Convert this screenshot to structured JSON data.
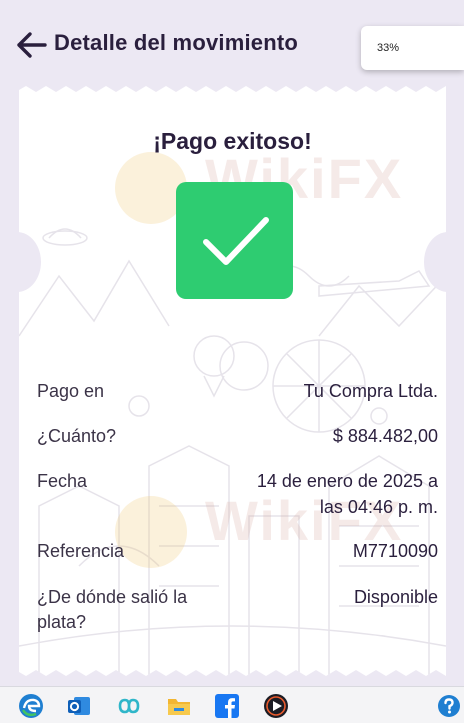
{
  "header": {
    "title": "Detalle del movimiento"
  },
  "zoom_popup": {
    "value": "33%"
  },
  "receipt": {
    "success_title": "¡Pago exitoso!",
    "rows": [
      {
        "label": "Pago en",
        "value": "Tu Compra Ltda."
      },
      {
        "label": "¿Cuánto?",
        "value": "$ 884.482,00"
      },
      {
        "label": "Fecha",
        "value_line1": "14 de enero de 2025 a",
        "value_line2": "las 04:46 p. m."
      },
      {
        "label": "Referencia",
        "value": "M7710090"
      },
      {
        "label_line1": "¿De dónde salió la",
        "label_line2": "plata?",
        "value": "Disponible"
      }
    ],
    "watermark_text": "WikiFX"
  },
  "taskbar": {
    "icons": [
      "edge-icon",
      "outlook-icon",
      "copilot-icon",
      "file-explorer-icon",
      "facebook-icon",
      "media-player-icon",
      "help-icon"
    ]
  },
  "colors": {
    "success_green": "#2ecc71",
    "page_background": "#ece8f3",
    "text_dark": "#2a1f3d"
  }
}
